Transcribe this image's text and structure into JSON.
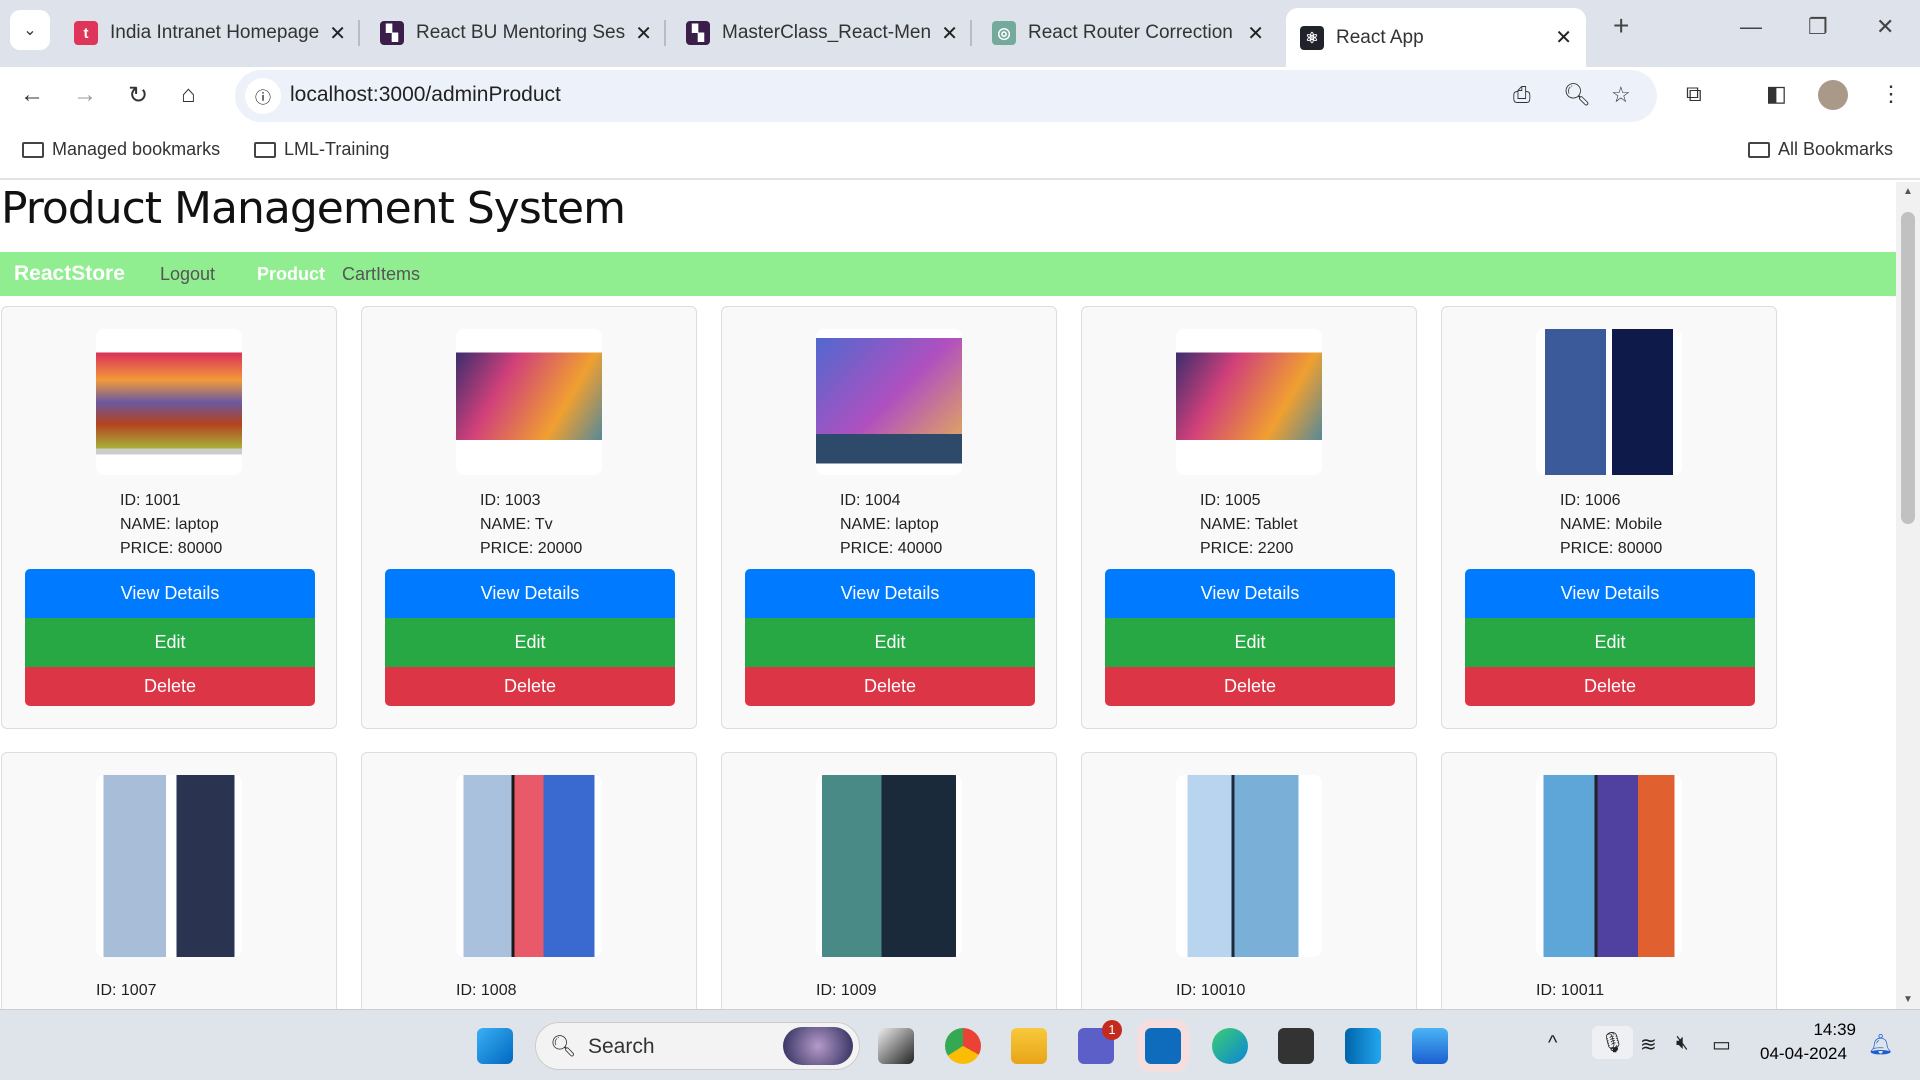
{
  "browser": {
    "tabs": [
      {
        "title": "India Intranet Homepage",
        "favicon_color": "#e0355a",
        "favicon_text": "t"
      },
      {
        "title": "React BU Mentoring Session",
        "favicon_color": "#3b1f4a",
        "favicon_text": "▚"
      },
      {
        "title": "MasterClass_React-Mentoring",
        "favicon_color": "#3b1f4a",
        "favicon_text": "▚"
      },
      {
        "title": "React Router Correction",
        "favicon_color": "#74aa9c",
        "favicon_text": "◎"
      },
      {
        "title": "React App",
        "favicon_color": "#20232a",
        "favicon_text": "⚛"
      }
    ],
    "url": "localhost:3000/adminProduct",
    "bookmarks": [
      "Managed bookmarks",
      "LML-Training"
    ],
    "all_bookmarks": "All Bookmarks"
  },
  "page": {
    "title": "Product Management System",
    "nav": {
      "brand": "ReactStore",
      "logout": "Logout",
      "product": "Product",
      "cart": "CartItems"
    },
    "buttons": {
      "view": "View Details",
      "edit": "Edit",
      "delete": "Delete"
    },
    "products": [
      {
        "id": "ID: 1001",
        "name": "NAME: laptop",
        "price": "PRICE: 80000",
        "image": "tv-landscape"
      },
      {
        "id": "ID: 1003",
        "name": "NAME: Tv",
        "price": "PRICE: 20000",
        "image": "tcl-tv"
      },
      {
        "id": "ID: 1004",
        "name": "NAME: laptop",
        "price": "PRICE: 40000",
        "image": "laptop"
      },
      {
        "id": "ID: 1005",
        "name": "NAME: Tablet",
        "price": "PRICE: 2200",
        "image": "tcl-tv"
      },
      {
        "id": "ID: 1006",
        "name": "NAME: Mobile",
        "price": "PRICE: 80000",
        "image": "htc-phone"
      },
      {
        "id": "ID: 1007",
        "image": "phone-blue"
      },
      {
        "id": "ID: 1008",
        "image": "iphone"
      },
      {
        "id": "ID: 1009",
        "image": "phone-teal"
      },
      {
        "id": "ID: 10010",
        "image": "redmi-12"
      },
      {
        "id": "ID: 10011",
        "image": "redmi-note-12"
      }
    ]
  },
  "taskbar": {
    "search": "Search",
    "time": "14:39",
    "date": "04-04-2024",
    "teams_badge": "1"
  }
}
